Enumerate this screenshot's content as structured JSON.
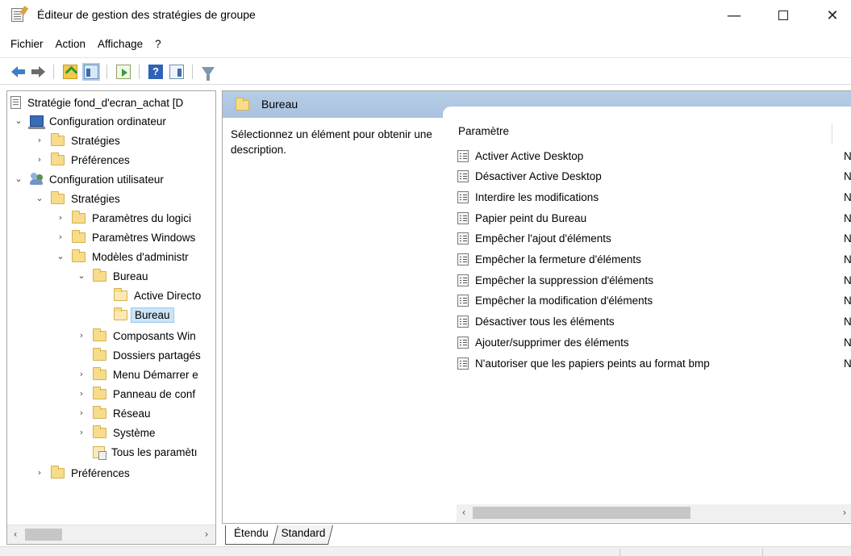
{
  "window": {
    "title": "Éditeur de gestion des stratégies de groupe",
    "minimize": "—",
    "close": "✕"
  },
  "menu": [
    "Fichier",
    "Action",
    "Affichage",
    "?"
  ],
  "toolbar": {
    "help_label": "?",
    "icons": [
      "back-arrow-icon",
      "forward-arrow-icon",
      "folder-up-icon",
      "show-hide-tree-icon",
      "export-list-icon",
      "help-icon",
      "show-action-pane-icon",
      "filter-icon"
    ]
  },
  "tree": {
    "root": "Stratégie fond_d'ecran_achat [D",
    "computer_config": "Configuration ordinateur",
    "computer_strategies": "Stratégies",
    "computer_preferences": "Préférences",
    "user_config": "Configuration utilisateur",
    "user_strategies": "Stratégies",
    "software_settings": "Paramètres du logici",
    "windows_settings": "Paramètres Windows",
    "admin_templates": "Modèles d'administr",
    "bureau": "Bureau",
    "active_directory": "Active Directo",
    "bureau_child": "Bureau",
    "windows_components": "Composants Win",
    "shared_folders": "Dossiers partagés",
    "start_menu": "Menu Démarrer e",
    "control_panel": "Panneau de conf",
    "network": "Réseau",
    "system": "Système",
    "all_settings": "Tous les paramètı",
    "user_preferences": "Préférences"
  },
  "right_pane": {
    "header_title": "Bureau",
    "description": "Sélectionnez un élément pour obtenir une description.",
    "column_header": "Paramètre",
    "settings": [
      {
        "name": "Activer Active Desktop",
        "state": "N"
      },
      {
        "name": "Désactiver Active Desktop",
        "state": "N"
      },
      {
        "name": "Interdire les modifications",
        "state": "N"
      },
      {
        "name": "Papier peint du Bureau",
        "state": "N"
      },
      {
        "name": "Empêcher l'ajout d'éléments",
        "state": "N"
      },
      {
        "name": "Empêcher la fermeture d'éléments",
        "state": "N"
      },
      {
        "name": "Empêcher la suppression d'éléments",
        "state": "N"
      },
      {
        "name": "Empêcher la modification d'éléments",
        "state": "N"
      },
      {
        "name": "Désactiver tous les éléments",
        "state": "N"
      },
      {
        "name": "Ajouter/supprimer des éléments",
        "state": "N"
      },
      {
        "name": "N'autoriser que les papiers peints au format bmp",
        "state": "N"
      }
    ]
  },
  "tabs": {
    "extended": "Étendu",
    "standard": "Standard"
  },
  "colors": {
    "header_bg": "#b7cde6",
    "selection_bg": "#cce4f7",
    "folder": "#f7dc8a"
  }
}
